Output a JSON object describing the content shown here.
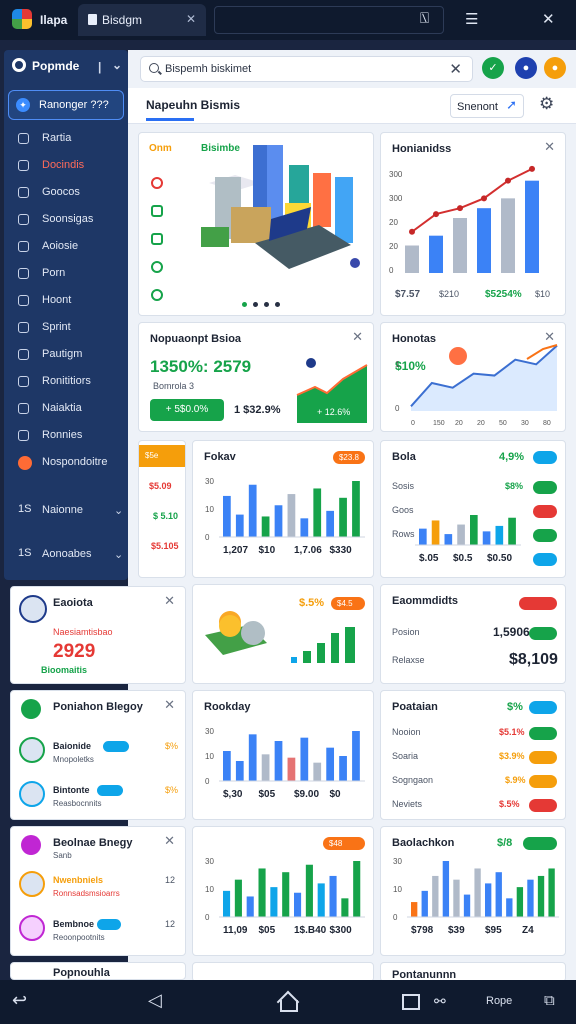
{
  "topbar": {
    "app": "Ilapa",
    "tab": "Bisdgm",
    "icons": [
      "window-icon",
      "tablet-icon",
      "close-icon"
    ]
  },
  "sidebar": {
    "brand": "Popmde",
    "active": "Ranonger ???",
    "items": [
      {
        "label": "Rartia",
        "color": "#e3e9f5"
      },
      {
        "label": "Docindis",
        "color": "#ff6b5a"
      },
      {
        "label": "Goocos",
        "color": "#e3e9f5"
      },
      {
        "label": "Soonsigas",
        "color": "#e3e9f5"
      },
      {
        "label": "Aoiosie",
        "color": "#e3e9f5"
      },
      {
        "label": "Porn",
        "color": "#e3e9f5"
      },
      {
        "label": "Hoont",
        "color": "#e3e9f5"
      },
      {
        "label": "Sprint",
        "color": "#e3e9f5"
      },
      {
        "label": "Pautigm",
        "color": "#e3e9f5"
      },
      {
        "label": "Ronititiors",
        "color": "#e3e9f5"
      },
      {
        "label": "Naiaktia",
        "color": "#e3e9f5"
      },
      {
        "label": "Ronnies",
        "color": "#e3e9f5"
      },
      {
        "label": "Nospondoitre",
        "color": "#e3e9f5"
      }
    ],
    "groups": [
      {
        "n": "1S",
        "label": "Naionne"
      },
      {
        "n": "1S",
        "label": "Aonoabes"
      }
    ]
  },
  "search": {
    "value": "Bispemh biskimet"
  },
  "header": {
    "title": "Napeuhn Bismis",
    "button": "Snenont"
  },
  "hero": {
    "tag1": "Onm",
    "tag2": "Bisimbe"
  },
  "c1": {
    "title": "Honianidss",
    "ticks": [
      "300",
      "300",
      "20",
      "20",
      "0"
    ],
    "vals": [
      "$7.57",
      "$210",
      "$5254%",
      "$10"
    ]
  },
  "c2": {
    "title": "Nopuaonpt Bsioa",
    "big": "1350%: 2579",
    "sub": "Bomrola 3",
    "b1": "+ 5$0.0%",
    "b2": "1 $32.9%",
    "b3": "+ 12.6%"
  },
  "c3": {
    "title": "Honotas",
    "big": "$10%",
    "ticks": [
      "1",
      "0"
    ],
    "x": [
      "0",
      "150",
      "20",
      "20",
      "50",
      "30",
      "80"
    ]
  },
  "c4": {
    "tag": "$5e",
    "vals": [
      "$5.09",
      "$ 5.10",
      "$5.105"
    ],
    "valsColors": [
      "#e53935",
      "#16a34a",
      "#e53935"
    ]
  },
  "c5": {
    "title": "Fokav",
    "pill": "$23.8",
    "ticks": [
      "30",
      "10",
      "0"
    ],
    "x": [
      "1,207",
      "$10",
      "1,7.06",
      "$330"
    ]
  },
  "c6": {
    "title": "Bola",
    "pct": "4,9%",
    "rows": [
      {
        "k": "Sosis",
        "v": "$8%",
        "p": "#16a34a"
      },
      {
        "k": "Goos",
        "v": "",
        "p": "#e53935"
      },
      {
        "k": "Rows",
        "v": "",
        "p": "#16a34a"
      },
      {
        "k": "",
        "v": "",
        "p": "#0ea5e9"
      }
    ],
    "x": [
      "$.05",
      "$0.5",
      "$0.50"
    ]
  },
  "c7": {
    "title": "Eaoiota",
    "sub": "Naesiamtisbao",
    "big": "2929",
    "tag": "Bioomaitis"
  },
  "c8": {
    "pct": "$.5%",
    "pill": "$4.5"
  },
  "c9": {
    "title": "Eaommdidts",
    "r1k": "Posion",
    "r1v": "1,5906",
    "r2k": "Relaxse",
    "r2v": "$8,109"
  },
  "c10": {
    "title": "Poniahon Blegoy",
    "people": [
      {
        "n": "Baionide",
        "s": "Mnopoletks",
        "v": "$%"
      },
      {
        "n": "Bintonte",
        "s": "Reasbocnnits",
        "v": "$%"
      }
    ]
  },
  "c11": {
    "title": "Rookday",
    "ticks": [
      "30",
      "10",
      "0"
    ],
    "x": [
      "$,30",
      "$05",
      "$9.00",
      "$0"
    ]
  },
  "c12": {
    "title": "Poataian",
    "pct": "$%",
    "rows": [
      {
        "k": "Nooion",
        "v": "$5.1%",
        "c": "#e53935"
      },
      {
        "k": "Soaria",
        "v": "$3.9%",
        "c": "#f59e0b"
      },
      {
        "k": "Sogngaon",
        "v": "$.9%",
        "c": "#f59e0b"
      },
      {
        "k": "Neviets",
        "v": "$.5%",
        "c": "#e53935"
      }
    ]
  },
  "c13": {
    "title": "Beolnae Bnegy",
    "sub": "Sanb",
    "people": [
      {
        "n": "Nwenbniels",
        "s": "Ronnsadsmsioarrs",
        "v": "12"
      },
      {
        "n": "Bembnoe",
        "s": "Reoonpootnits",
        "v": "12"
      }
    ]
  },
  "c14": {
    "pill": "$48",
    "ticks": [
      "30",
      "10",
      "0"
    ],
    "x": [
      "11,09",
      "$05",
      "1$.B40",
      "$300"
    ]
  },
  "c15": {
    "title": "Baolachkon",
    "pct": "$/8",
    "ticks": [
      "30",
      "10",
      "0"
    ],
    "x": [
      "$798",
      "$39",
      "$95",
      "Z4"
    ]
  },
  "bottom": {
    "c1": "Popnouhla",
    "c3": "Pontanunnn",
    "label": "Rope"
  },
  "chart_data": [
    {
      "type": "bar",
      "title": "Honianidss",
      "categories": [
        "1",
        "2",
        "3",
        "4",
        "5",
        "6"
      ],
      "values": [
        70,
        95,
        140,
        165,
        190,
        235
      ],
      "line": [
        105,
        150,
        165,
        190,
        235,
        265
      ]
    },
    {
      "type": "line",
      "title": "Honotas",
      "x": [
        0,
        1,
        2,
        3,
        4,
        5,
        6,
        7
      ],
      "values": [
        5,
        30,
        25,
        40,
        38,
        55,
        50,
        70
      ]
    },
    {
      "type": "bar",
      "title": "Fokav",
      "values": [
        22,
        12,
        28,
        11,
        17,
        23,
        10,
        26,
        14,
        21,
        30
      ]
    },
    {
      "type": "bar",
      "title": "Bola",
      "values": [
        12,
        18,
        8,
        15,
        22,
        10,
        14,
        20
      ]
    },
    {
      "type": "bar",
      "title": "Rookday",
      "values": [
        18,
        12,
        28,
        16,
        24,
        14,
        26,
        11,
        20,
        15,
        30
      ]
    },
    {
      "type": "bar",
      "title": "Beolnae",
      "values": [
        14,
        20,
        11,
        26,
        16,
        24,
        13,
        28,
        18,
        22,
        10,
        30
      ]
    },
    {
      "type": "bar",
      "title": "Baolachkon",
      "values": [
        8,
        14,
        22,
        30,
        20,
        12,
        26,
        18,
        24,
        10,
        16,
        20,
        22,
        26
      ]
    }
  ]
}
